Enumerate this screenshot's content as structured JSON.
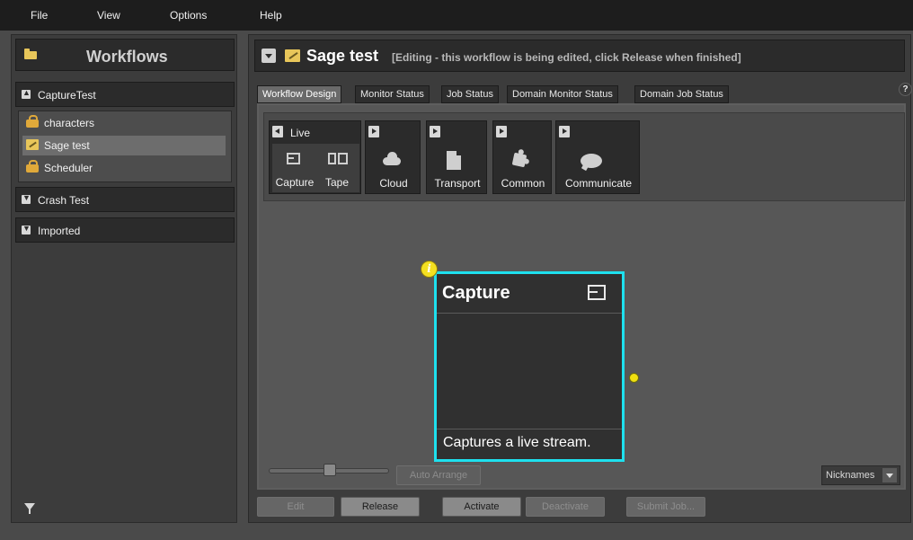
{
  "menu": {
    "file": "File",
    "view": "View",
    "options": "Options",
    "help": "Help"
  },
  "sidebar": {
    "title": "Workflows",
    "groups": [
      {
        "label": "CaptureTest",
        "items": [
          {
            "label": "characters",
            "icon": "lock-icon"
          },
          {
            "label": "Sage test",
            "icon": "pencil-icon",
            "selected": true
          },
          {
            "label": "Scheduler",
            "icon": "lock-icon"
          }
        ]
      },
      {
        "label": "Crash Test"
      },
      {
        "label": "Imported"
      }
    ]
  },
  "workflow": {
    "name": "Sage test",
    "status_note": "[Editing - this workflow is being edited, click Release when finished]"
  },
  "tabs": [
    "Workflow Design",
    "Monitor Status",
    "Job Status",
    "Domain Monitor Status",
    "Domain Job Status"
  ],
  "help_label": "?",
  "palette": {
    "live_label": "Live",
    "items": [
      {
        "label": "Capture",
        "icon": "capture-icon"
      },
      {
        "label": "Tape",
        "icon": "tape-icon"
      },
      {
        "label": "Cloud",
        "icon": "cloud-icon"
      },
      {
        "label": "Transport",
        "icon": "document-icon"
      },
      {
        "label": "Common",
        "icon": "puzzle-icon"
      },
      {
        "label": "Communicate",
        "icon": "chat-icon"
      }
    ]
  },
  "node": {
    "title": "Capture",
    "description": "Captures a live stream.",
    "info_label": "i"
  },
  "canvas_controls": {
    "auto_arrange": "Auto Arrange",
    "nicknames": "Nicknames",
    "zoom_level": 0.5
  },
  "actions": {
    "edit": "Edit",
    "release": "Release",
    "activate": "Activate",
    "deactivate": "Deactivate",
    "submit_job": "Submit Job..."
  },
  "colors": {
    "node_border": "#1ee0ee",
    "port": "#f0e010",
    "accent_folder": "#e8c65a"
  }
}
